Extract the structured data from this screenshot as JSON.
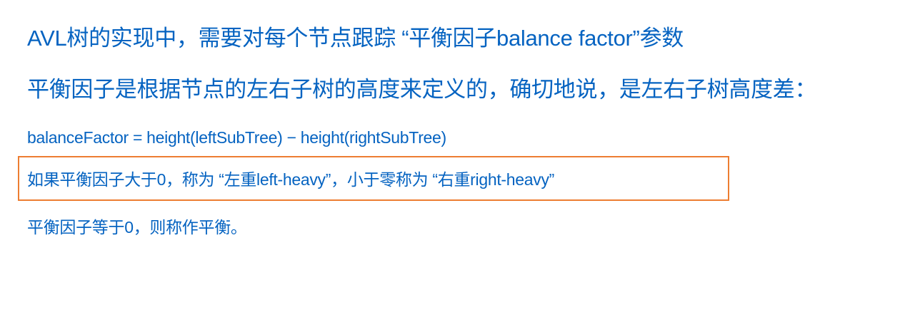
{
  "lines": {
    "line1": "AVL树的实现中，需要对每个节点跟踪 “平衡因子balance factor”参数",
    "line2": "平衡因子是根据节点的左右子树的高度来定义的，确切地说，是左右子树高度差：",
    "line3": "balanceFactor = height(leftSubTree)  −  height(rightSubTree)",
    "line4": "如果平衡因子大于0，称为 “左重left-heavy”，小于零称为 “右重right-heavy”",
    "line5": "平衡因子等于0，则称作平衡。"
  },
  "colors": {
    "text": "#0563c1",
    "highlight_border": "#ed7d31",
    "background": "#ffffff"
  }
}
